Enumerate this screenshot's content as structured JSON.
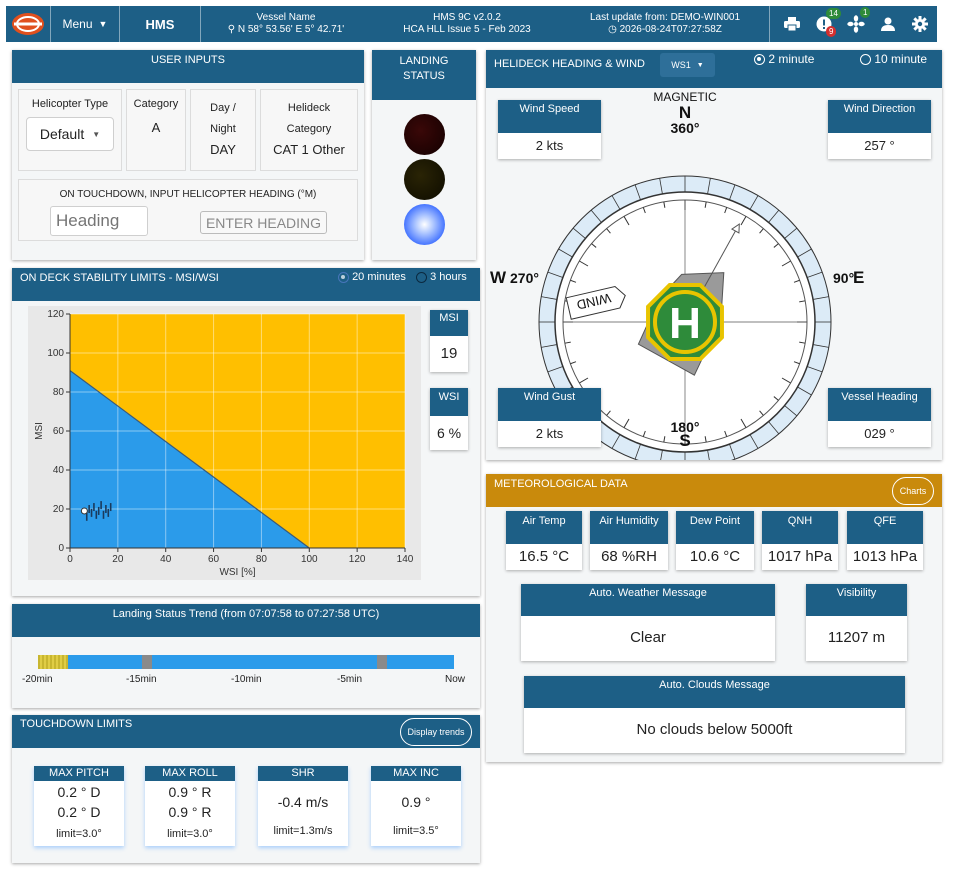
{
  "header": {
    "menu_label": "Menu",
    "app_name": "HMS",
    "vessel_name_label": "Vessel Name",
    "vessel_position": "N 58° 53.56'   E 5° 42.71'",
    "version": "HMS 9C v2.0.2",
    "issue": "HCA HLL Issue 5 - Feb 2023",
    "last_update_label": "Last update from: DEMO-WIN001",
    "last_update_time": "2026-08-24T07:27:58Z",
    "alert_badge_green": "14",
    "alert_badge_red": "9",
    "fan_badge": "1"
  },
  "user_inputs": {
    "title": "USER INPUTS",
    "helicopter_type_label": "Helicopter Type",
    "helicopter_type_value": "Default",
    "category_label": "Category",
    "category_value": "A",
    "day_night_label": "Day / Night",
    "day_night_value": "DAY",
    "helideck_category_label": "Helideck Category",
    "helideck_category_value": "CAT 1 Other",
    "touchdown_instruction": "ON TOUCHDOWN, INPUT HELICOPTER HEADING (°M)",
    "heading_placeholder": "Heading",
    "enter_heading_label": "ENTER HEADING"
  },
  "landing_status": {
    "title": "LANDING STATUS",
    "red_color": "#2a0000",
    "amber_color": "#1f1a00",
    "blue_color": "#3a6cff"
  },
  "stability": {
    "title": "ON DECK STABILITY LIMITS - MSI/WSI",
    "option_20": "20 minutes",
    "option_3h": "3 hours",
    "msi_label": "MSI",
    "msi_value": "19",
    "wsi_label": "WSI",
    "wsi_value": "6 %"
  },
  "chart_data": {
    "type": "area",
    "xlabel": "WSI [%]",
    "ylabel": "MSI",
    "xlim": [
      0,
      140
    ],
    "ylim": [
      0,
      120
    ],
    "x_ticks": [
      "0",
      "20",
      "40",
      "60",
      "80",
      "100",
      "120",
      "140"
    ],
    "y_ticks": [
      "0",
      "20",
      "40",
      "60",
      "80",
      "100",
      "120"
    ],
    "limit_line": [
      [
        0,
        91
      ],
      [
        100,
        0
      ]
    ],
    "safe_color": "#2b9bea",
    "unsafe_color": "#ffbf00",
    "current_point": [
      6,
      19
    ],
    "history_points": [
      [
        7,
        16
      ],
      [
        8,
        20
      ],
      [
        9,
        18
      ],
      [
        10,
        21
      ],
      [
        11,
        17
      ],
      [
        12,
        19
      ],
      [
        13,
        22
      ],
      [
        14,
        17
      ],
      [
        15,
        20
      ],
      [
        16,
        18
      ],
      [
        17,
        21
      ]
    ]
  },
  "trend": {
    "title": "Landing Status Trend (from 07:07:58 to 07:27:58 UTC)",
    "labels": [
      "-20min",
      "-15min",
      "-10min",
      "-5min",
      "Now"
    ]
  },
  "touchdown": {
    "title": "TOUCHDOWN LIMITS",
    "display_trends_label": "Display trends",
    "cards": [
      {
        "label": "MAX PITCH",
        "value1": "0.2 ° D",
        "value2": "0.2 ° D",
        "limit": "limit=3.0°"
      },
      {
        "label": "MAX ROLL",
        "value1": "0.9 ° R",
        "value2": "0.9 ° R",
        "limit": "limit=3.0°"
      },
      {
        "label": "SHR",
        "value1": "-0.4 m/s",
        "limit": "limit=1.3m/s"
      },
      {
        "label": "MAX INC",
        "value1": "0.9 °",
        "limit": "limit=3.5°"
      }
    ]
  },
  "helideck": {
    "title": "HELIDECK HEADING & WIND",
    "sensor": "WS1",
    "opt_2min": "2 minute",
    "opt_10min": "10 minute",
    "compass_label": "MAGNETIC",
    "north": "N",
    "north_deg": "360°",
    "south": "S",
    "south_deg": "180°",
    "west": "W",
    "west_deg": "270°",
    "east": "E",
    "east_deg": "90°",
    "wind_tag": "WIND",
    "helipad_letter": "H",
    "wind_speed_label": "Wind Speed",
    "wind_speed_value": "2 kts",
    "wind_direction_label": "Wind Direction",
    "wind_direction_value": "257 °",
    "wind_gust_label": "Wind Gust",
    "wind_gust_value": "2 kts",
    "vessel_heading_label": "Vessel Heading",
    "vessel_heading_value": "029 °",
    "wind_direction_deg": 257,
    "vessel_heading_deg": 29
  },
  "met": {
    "title": "METEOROLOGICAL DATA",
    "charts_label": "Charts",
    "air_temp_label": "Air Temp",
    "air_temp_value": "16.5 °C",
    "air_humidity_label": "Air Humidity",
    "air_humidity_value": "68 %RH",
    "dew_point_label": "Dew Point",
    "dew_point_value": "10.6 °C",
    "qnh_label": "QNH",
    "qnh_value": "1017 hPa",
    "qfe_label": "QFE",
    "qfe_value": "1013 hPa",
    "weather_msg_label": "Auto. Weather Message",
    "weather_msg_value": "Clear",
    "visibility_label": "Visibility",
    "visibility_value": "11207 m",
    "clouds_label": "Auto. Clouds Message",
    "clouds_value": "No clouds below 5000ft"
  }
}
